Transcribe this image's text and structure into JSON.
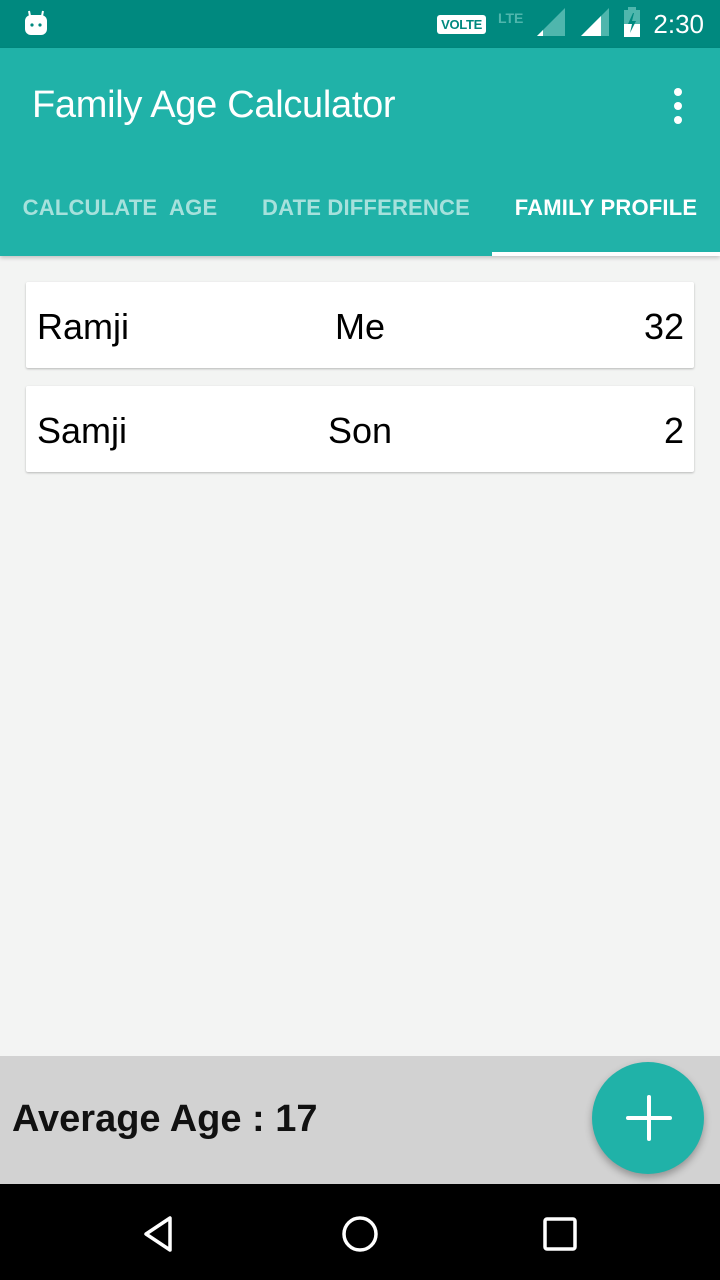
{
  "status_bar": {
    "notification_icon": "android-robot-icon",
    "volte_label": "VOLTE",
    "lte_label": "LTE",
    "time": "2:30"
  },
  "app_bar": {
    "title": "Family Age Calculator",
    "overflow_icon": "more-vertical-icon"
  },
  "tabs": [
    {
      "label": "CALCULATE  AGE",
      "active": false
    },
    {
      "label": "DATE DIFFERENCE",
      "active": false
    },
    {
      "label": "FAMILY PROFILE",
      "active": true
    }
  ],
  "members": [
    {
      "name": "Ramji",
      "relation": "Me",
      "age": "32"
    },
    {
      "name": "Samji",
      "relation": "Son",
      "age": "2"
    }
  ],
  "footer": {
    "average_label": "Average Age : 17"
  },
  "fab": {
    "icon": "plus-icon"
  },
  "nav_bar": {
    "back_icon": "back-triangle-icon",
    "home_icon": "home-circle-icon",
    "recents_icon": "recents-square-icon"
  },
  "colors": {
    "primary": "#20b2a8",
    "primary_dark": "#00897f",
    "footer_bg": "#d2d2d2"
  }
}
